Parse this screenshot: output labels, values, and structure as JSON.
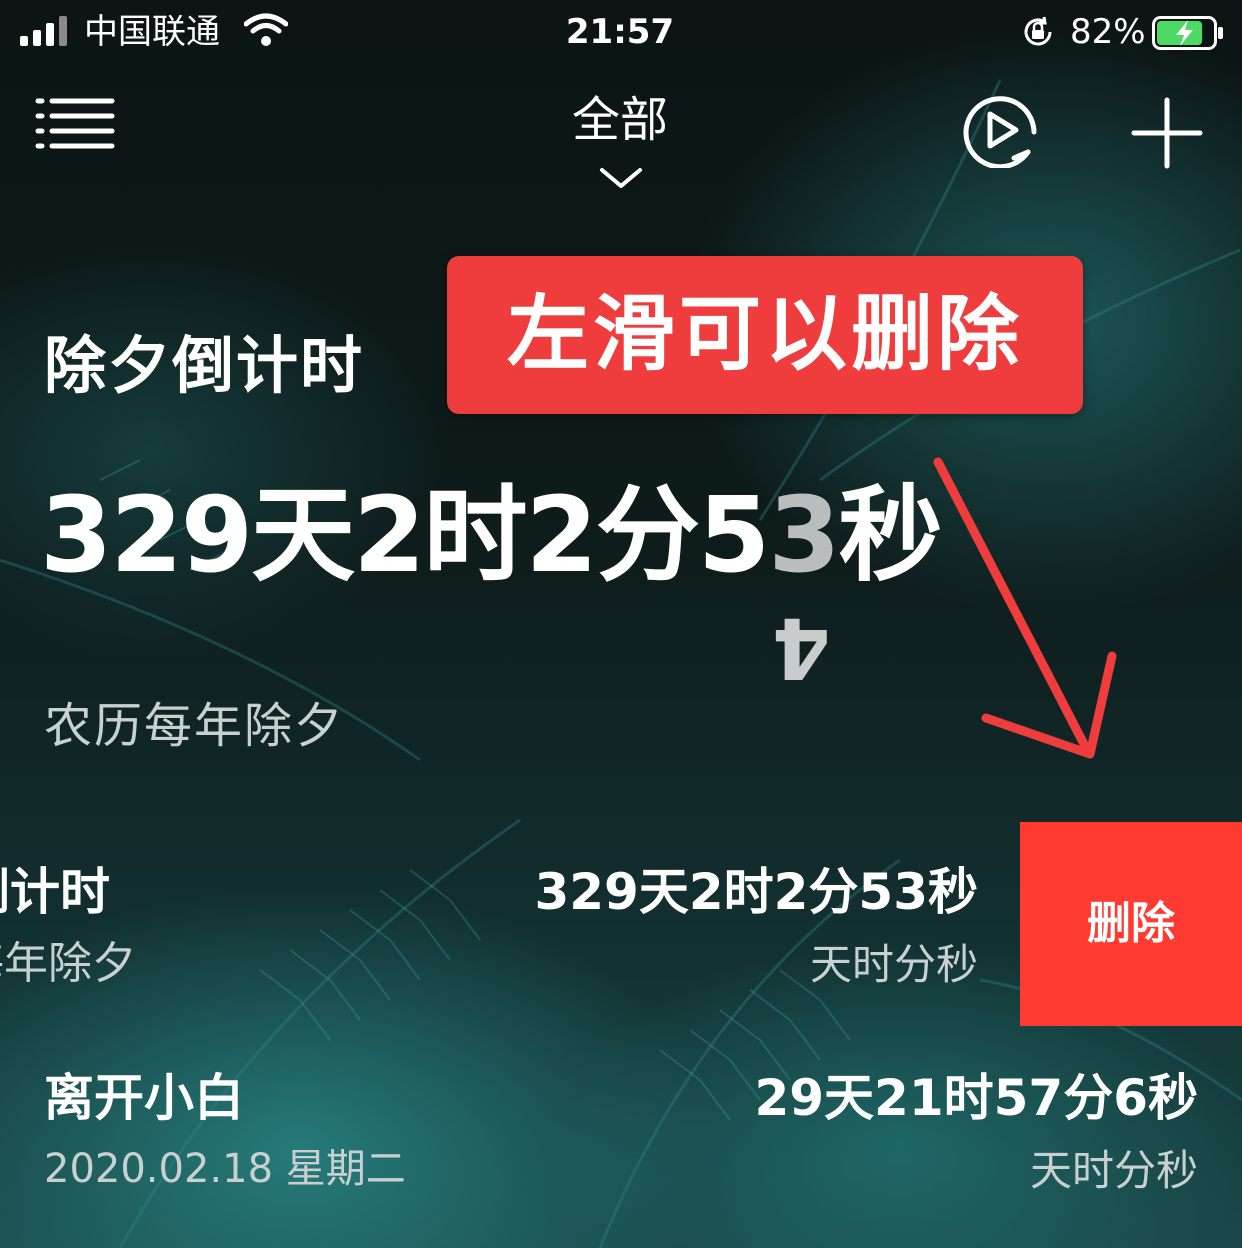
{
  "status_bar": {
    "carrier": "中国联通",
    "time": "21:57",
    "battery_percent": "82%",
    "battery_level": 0.82,
    "battery_color": "#4cd964",
    "icons": [
      "signal-icon",
      "wifi-icon",
      "orientation-lock-icon",
      "battery-charging-icon"
    ]
  },
  "nav": {
    "title": "全部",
    "icons": [
      "menu-icon",
      "chevron-down-icon",
      "play-icon",
      "plus-icon"
    ]
  },
  "featured": {
    "title": "除夕倒计时",
    "counter_main": "329天2时2分5",
    "counter_dim_digit": "3",
    "counter_suffix": "秒",
    "flip_digit": "4",
    "subtitle": "农历每年除夕"
  },
  "callout": {
    "text": "左滑可以删除",
    "color": "#ef3c3c"
  },
  "list": {
    "items": [
      {
        "title": "倒计时",
        "subtitle": "每年除夕",
        "counter": "329天2时2分53秒",
        "unit": "天时分秒",
        "action_label": "删除",
        "action_color": "#ff3a30"
      },
      {
        "title": "离开小白",
        "subtitle": "2020.02.18  星期二",
        "counter": "29天21时57分6秒",
        "unit": "天时分秒"
      }
    ]
  }
}
